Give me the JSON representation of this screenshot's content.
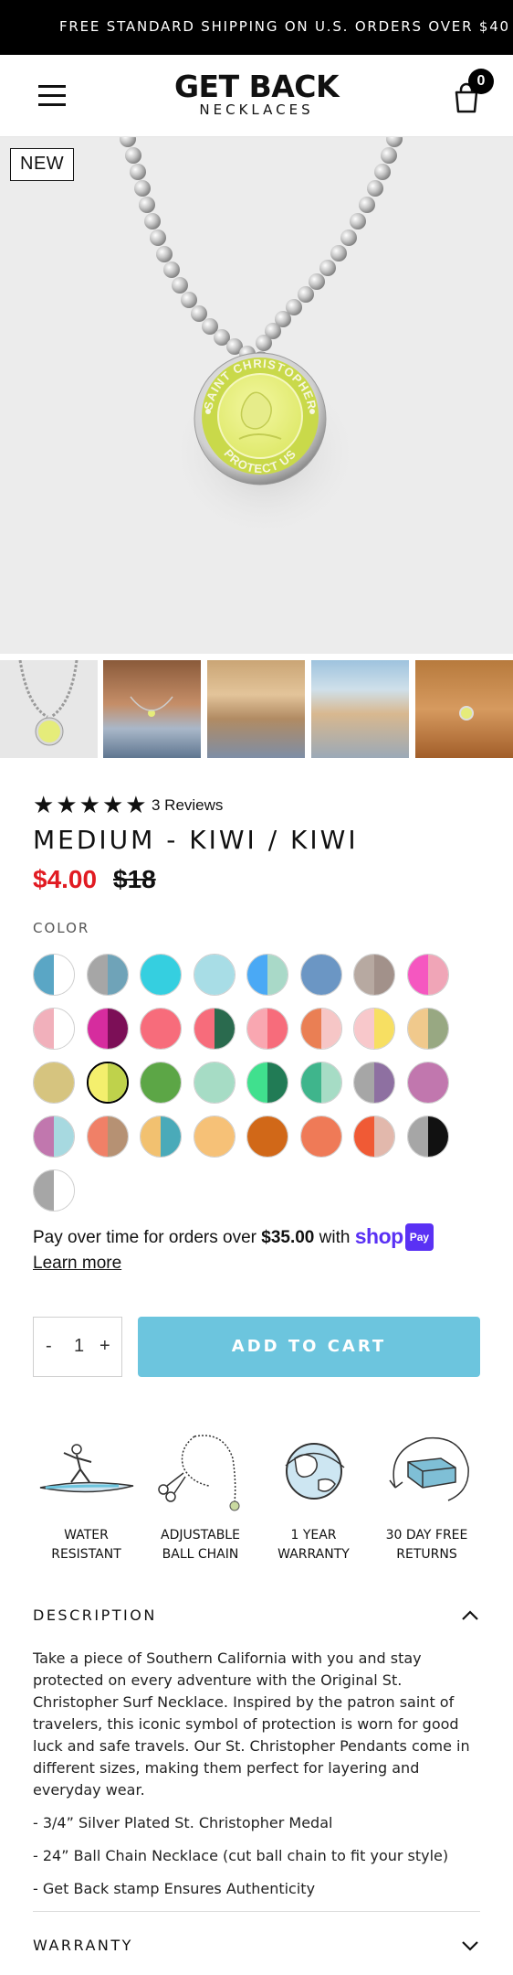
{
  "announcement": "FREE STANDARD SHIPPING ON U.S. ORDERS OVER $40",
  "header": {
    "logo_line1": "GET BACK",
    "logo_line2": "NECKLACES",
    "cart_count": "0"
  },
  "product": {
    "badge": "NEW",
    "pendant_text_top": "SAINT CHRISTOPHER",
    "pendant_text_bottom": "PROTECT US",
    "rating_stars": 5,
    "reviews": "3 Reviews",
    "title": "MEDIUM - KIWI / KIWI",
    "price": "$4.00",
    "compare_price": "$18"
  },
  "color": {
    "label": "COLOR",
    "swatches": [
      {
        "l": "#5aa6c5",
        "r": "#ffffff"
      },
      {
        "l": "#a6a6a6",
        "r": "#6fa3b8"
      },
      {
        "l": "#35cfe0",
        "r": "#35cfe0"
      },
      {
        "l": "#a8dde6",
        "r": "#a8dde6"
      },
      {
        "l": "#4aa9f5",
        "r": "#a9d9c8"
      },
      {
        "l": "#6b96c4",
        "r": "#6b96c4"
      },
      {
        "l": "#b7a9a1",
        "r": "#a2918a"
      },
      {
        "l": "#f557c0",
        "r": "#f0a5b7"
      },
      {
        "l": "#f1b0bb",
        "r": "#ffffff"
      },
      {
        "l": "#d62c9e",
        "r": "#7c0f57"
      },
      {
        "l": "#f76c7b",
        "r": "#f76c7b"
      },
      {
        "l": "#f76c7b",
        "r": "#2a6a4e"
      },
      {
        "l": "#f9a7b1",
        "r": "#f76c7b"
      },
      {
        "l": "#ea7f54",
        "r": "#f6c6c6"
      },
      {
        "l": "#f8c8cb",
        "r": "#f7df62"
      },
      {
        "l": "#f0c98c",
        "r": "#98a882"
      },
      {
        "l": "#d6c47f",
        "r": "#d6c47f"
      },
      {
        "l": "#f4ef6d",
        "r": "#bfd24b"
      },
      {
        "l": "#5ca646",
        "r": "#5ca646"
      },
      {
        "l": "#a6dcc5",
        "r": "#a6dcc5"
      },
      {
        "l": "#40e08e",
        "r": "#217b55"
      },
      {
        "l": "#3fb58c",
        "r": "#a6dcc5"
      },
      {
        "l": "#a6a6a6",
        "r": "#8e70a1"
      },
      {
        "l": "#c177ae",
        "r": "#c177ae"
      },
      {
        "l": "#c177ae",
        "r": "#a7d9e0"
      },
      {
        "l": "#f08067",
        "r": "#b69173"
      },
      {
        "l": "#f2c170",
        "r": "#4aaab9"
      },
      {
        "l": "#f6c177",
        "r": "#f6c177"
      },
      {
        "l": "#d16818",
        "r": "#d16818"
      },
      {
        "l": "#ef7a57",
        "r": "#ef7a57"
      },
      {
        "l": "#f05a35",
        "r": "#e2b8ac"
      },
      {
        "l": "#a6a6a6",
        "r": "#111111"
      },
      {
        "l": "#a6a6a6",
        "r": "#ffffff"
      }
    ],
    "selected_index": 17
  },
  "shoppay": {
    "text_before": "Pay over time for orders over ",
    "amount": "$35.00",
    "text_after": " with ",
    "brand": "shop",
    "brand_tag": "Pay",
    "learn_more": "Learn more"
  },
  "cart_controls": {
    "minus": "-",
    "quantity": "1",
    "plus": "+",
    "add_to_cart": "ADD TO CART"
  },
  "features": [
    {
      "label": "WATER\nRESISTANT"
    },
    {
      "label": "ADJUSTABLE\nBALL CHAIN"
    },
    {
      "label": "1 YEAR\nWARRANTY"
    },
    {
      "label": "30 DAY FREE\nRETURNS"
    }
  ],
  "description": {
    "heading": "DESCRIPTION",
    "body": "Take a piece of Southern California with you and stay protected on every adventure with the Original St. Christopher Surf Necklace. Inspired by the patron saint of travelers, this iconic symbol of protection is worn for good luck and safe travels. Our St. Christopher Pendants come in different sizes, making them perfect for layering and everyday wear.",
    "bullets": [
      "- 3/4” Silver Plated St. Christopher Medal",
      "- 24” Ball Chain Necklace (cut ball chain to fit your style)",
      "- Get Back stamp Ensures Authenticity"
    ]
  },
  "warranty": {
    "heading": "WARRANTY"
  }
}
